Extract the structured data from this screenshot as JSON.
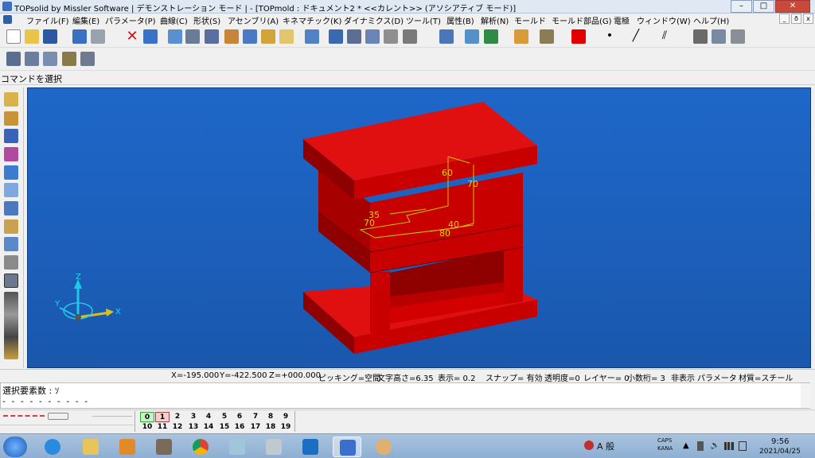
{
  "window": {
    "title": "TOPsolid by Missler Software | デモンストレーション モード | - [TOPmold : ドキュメント2 *  <<カレント>> (アソシアティブ モード)]",
    "minimize": "–",
    "maximize": "□",
    "close": "✕"
  },
  "menubar": {
    "items": [
      "ファイル(F)",
      "編集(E)",
      "パラメータ(P)",
      "曲線(C)",
      "形状(S)",
      "アセンブリ(A)",
      "キネマチック(K)",
      "ダイナミクス(D)",
      "ツール(T)",
      "属性(B)",
      "解析(N)",
      "モールド",
      "モールド部品(G)",
      "電極",
      "ウィンドウ(W)",
      "ヘルプ(H)"
    ],
    "doc_buttons": [
      "_",
      "ð",
      "x"
    ]
  },
  "command_prompt": "コマンドを選択",
  "viewport": {
    "dimensions": [
      "60",
      "70",
      "35",
      "70",
      "40",
      "80"
    ],
    "axes": {
      "z": "Z",
      "y": "Y",
      "x": "X"
    },
    "colors": {
      "background": "#1c5fbb",
      "part": "#c80000",
      "part_dark": "#8f0000",
      "part_light": "#e01010",
      "dim": "#c8c800"
    }
  },
  "status": {
    "x": "X=-195.000",
    "y": "Y=-422.500",
    "z": "Z=+000.000",
    "picking": "ピッキング=空間",
    "text_height": "文字高さ=6.35",
    "display": "表示=   0.2",
    "snap": "スナップ= 有効",
    "transparency": "透明度=0",
    "layer": "レイヤー=  0",
    "decimals": "小数桁= 3",
    "hide": "非表示",
    "param": "パラメータ",
    "material": "材質=スチール"
  },
  "output": {
    "line1": "選択要素数 : ｿ",
    "line2": "- - - - - - - - - -"
  },
  "layers": {
    "row1": [
      "0",
      "1",
      "2",
      "3",
      "4",
      "5",
      "6",
      "7",
      "8",
      "9"
    ],
    "row2": [
      "10",
      "11",
      "12",
      "13",
      "14",
      "15",
      "16",
      "17",
      "18",
      "19"
    ]
  },
  "taskbar": {
    "time": "9:56",
    "date": "2021/04/25",
    "ime": "A 般",
    "caps": "CAPS",
    "kana": "KANA"
  }
}
